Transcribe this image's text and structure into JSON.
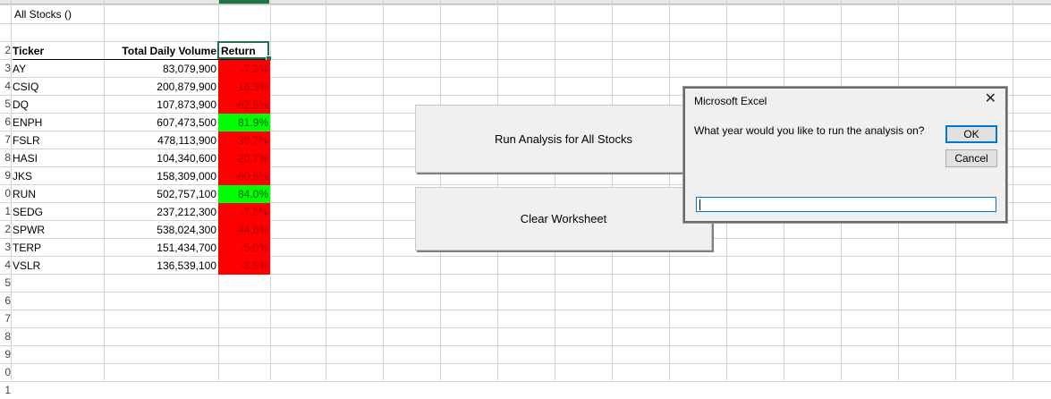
{
  "sheet": {
    "title_cell": "All Stocks ()",
    "headers": {
      "ticker": "Ticker",
      "volume": "Total Daily Volume",
      "return": "Return"
    },
    "rows": [
      {
        "ticker": "AY",
        "volume": "83,079,900",
        "return": "-7.3%",
        "sign": "neg"
      },
      {
        "ticker": "CSIQ",
        "volume": "200,879,900",
        "return": "-16.3%",
        "sign": "neg"
      },
      {
        "ticker": "DQ",
        "volume": "107,873,900",
        "return": "-62.6%",
        "sign": "neg"
      },
      {
        "ticker": "ENPH",
        "volume": "607,473,500",
        "return": "81.9%",
        "sign": "pos"
      },
      {
        "ticker": "FSLR",
        "volume": "478,113,900",
        "return": "-39.7%",
        "sign": "neg"
      },
      {
        "ticker": "HASI",
        "volume": "104,340,600",
        "return": "-20.7%",
        "sign": "neg"
      },
      {
        "ticker": "JKS",
        "volume": "158,309,000",
        "return": "-60.5%",
        "sign": "neg"
      },
      {
        "ticker": "RUN",
        "volume": "502,757,100",
        "return": "84.0%",
        "sign": "pos"
      },
      {
        "ticker": "SEDG",
        "volume": "237,212,300",
        "return": "-7.8%",
        "sign": "neg"
      },
      {
        "ticker": "SPWR",
        "volume": "538,024,300",
        "return": "-44.6%",
        "sign": "neg"
      },
      {
        "ticker": "TERP",
        "volume": "151,434,700",
        "return": "-5.0%",
        "sign": "neg"
      },
      {
        "ticker": "VSLR",
        "volume": "136,539,100",
        "return": "-3.5%",
        "sign": "neg"
      }
    ],
    "row_numbers": [
      "",
      "2",
      "3",
      "4",
      "5",
      "6",
      "7",
      "8",
      "9",
      "0",
      "1",
      "2",
      "3",
      "4",
      "5",
      "6",
      "7",
      "8",
      "9",
      "0",
      "1"
    ]
  },
  "buttons": {
    "run_analysis": "Run Analysis for All Stocks",
    "clear_worksheet": "Clear Worksheet"
  },
  "dialog": {
    "title": "Microsoft Excel",
    "close_glyph": "✕",
    "prompt": "What year would you like to run the analysis on?",
    "ok_label": "OK",
    "cancel_label": "Cancel",
    "input_value": ""
  },
  "colors": {
    "negative_fill": "#ff0000",
    "positive_fill": "#00ff00",
    "selection": "#217346",
    "dialog_accent": "#0078d7"
  }
}
